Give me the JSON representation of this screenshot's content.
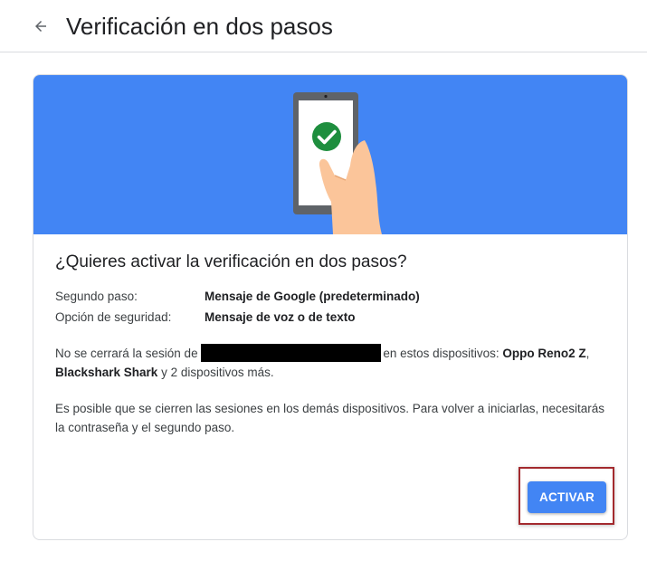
{
  "header": {
    "back_icon": "arrow-back-icon",
    "title": "Verificación en dos pasos"
  },
  "banner": {
    "illustration": "phone-checkmark-illustration",
    "background_color": "#4285f4",
    "check_color": "#1e8e3e"
  },
  "card": {
    "question": "¿Quieres activar la verificación en dos pasos?",
    "details": [
      {
        "label": "Segundo paso:",
        "value": "Mensaje de Google (predeterminado)"
      },
      {
        "label": "Opción de seguridad:",
        "value": "Mensaje de voz o de texto"
      }
    ],
    "session_notice": {
      "prefix": "No se cerrará la sesión de ",
      "middle": "en estos dispositivos: ",
      "device1": "Oppo Reno2 Z",
      "sep1": ", ",
      "device2": "Blackshark Shark",
      "suffix": " y 2 dispositivos más."
    },
    "warning": "Es posible que se cierren las sesiones en los demás dispositivos. Para volver a iniciarlas, necesitarás la contraseña y el segundo paso."
  },
  "actions": {
    "activate_label": "ACTIVAR",
    "accent_color": "#4285f4",
    "highlight_color": "#a32a2e"
  }
}
